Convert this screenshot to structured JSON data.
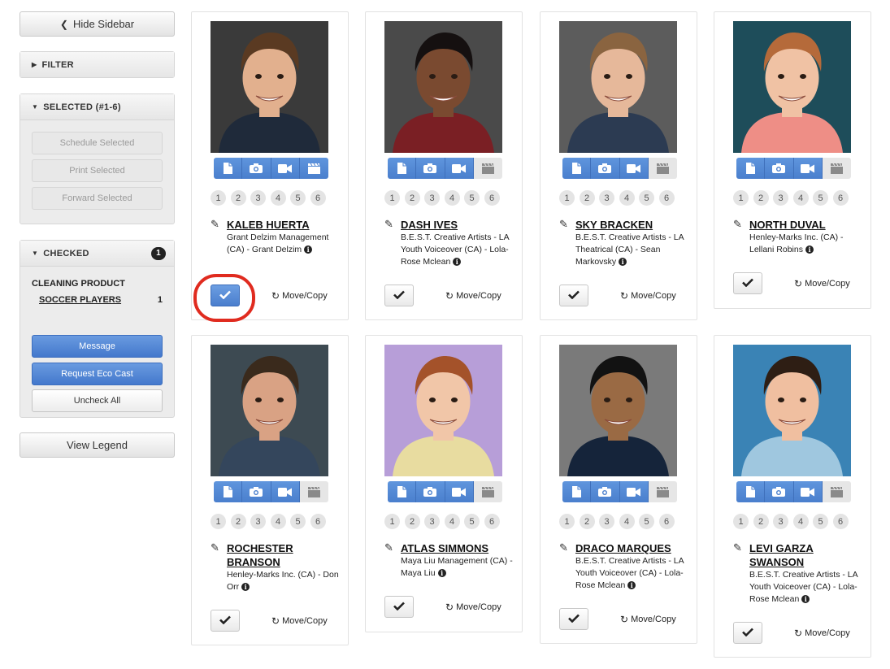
{
  "sidebar": {
    "hide_label": "Hide Sidebar",
    "filter_label": "FILTER",
    "selected": {
      "title": "SELECTED (#1-6)",
      "buttons": [
        "Schedule Selected",
        "Print Selected",
        "Forward Selected"
      ]
    },
    "checked": {
      "title": "CHECKED",
      "count": "1",
      "project": "CLEANING PRODUCT",
      "role": "SOCCER PLAYERS",
      "role_count": "1",
      "message_label": "Message",
      "eco_label": "Request Eco Cast",
      "uncheck_label": "Uncheck All"
    },
    "legend_label": "View Legend"
  },
  "card_common": {
    "numbers": [
      "1",
      "2",
      "3",
      "4",
      "5",
      "6"
    ],
    "move_label": "Move/Copy"
  },
  "cards": [
    {
      "name": "KALEB HUERTA",
      "agency": "Grant Delzim Management (CA) - Grant Delzim",
      "checked": true,
      "media_on": [
        true,
        true,
        true,
        true
      ],
      "bg": "#3a3a3a",
      "skin": "#e2b08e",
      "hair": "#5a3a22",
      "shirt": "#1f2a3a"
    },
    {
      "name": "DASH IVES",
      "agency": "B.E.S.T. Creative Artists - LA Youth Voiceover (CA) - Lola-Rose Mclean",
      "checked": false,
      "media_on": [
        true,
        true,
        true,
        false
      ],
      "bg": "#4a4a4a",
      "skin": "#7a4a30",
      "hair": "#151010",
      "shirt": "#7a1f24"
    },
    {
      "name": "SKY BRACKEN",
      "agency": "B.E.S.T. Creative Artists - LA Theatrical (CA) - Sean Markovsky",
      "checked": false,
      "media_on": [
        true,
        true,
        true,
        false
      ],
      "bg": "#5c5c5c",
      "skin": "#e6b89a",
      "hair": "#8a6440",
      "shirt": "#2c3b52"
    },
    {
      "name": "NORTH DUVAL",
      "agency": "Henley-Marks Inc. (CA) - Lellani Robins",
      "checked": false,
      "media_on": [
        true,
        true,
        true,
        false
      ],
      "bg": "#1e4d5a",
      "skin": "#f0c2a4",
      "hair": "#b56a3a",
      "shirt": "#ee8e86"
    },
    {
      "name": "ROCHESTER BRANSON",
      "agency": "Henley-Marks Inc. (CA) - Don Orr",
      "checked": false,
      "media_on": [
        true,
        true,
        true,
        false
      ],
      "bg": "#3d4a52",
      "skin": "#d9a284",
      "hair": "#3a2a1c",
      "shirt": "#34465c"
    },
    {
      "name": "ATLAS SIMMONS",
      "agency": "Maya Liu Management (CA) - Maya Liu",
      "checked": false,
      "media_on": [
        true,
        true,
        true,
        false
      ],
      "bg": "#b79ed8",
      "skin": "#f1c6a8",
      "hair": "#a4522a",
      "shirt": "#e8dca0"
    },
    {
      "name": "DRACO MARQUES",
      "agency": "B.E.S.T. Creative Artists - LA Youth Voiceover (CA) - Lola-Rose Mclean",
      "checked": false,
      "media_on": [
        true,
        true,
        true,
        false
      ],
      "bg": "#7a7a7a",
      "skin": "#9a6a44",
      "hair": "#121212",
      "shirt": "#15243a"
    },
    {
      "name": "LEVI GARZA SWANSON",
      "agency": "B.E.S.T. Creative Artists - LA Youth Voiceover (CA) - Lola-Rose Mclean",
      "checked": false,
      "media_on": [
        true,
        true,
        true,
        false
      ],
      "bg": "#3a83b5",
      "skin": "#f0bfa0",
      "hair": "#2e1e14",
      "shirt": "#9fc7df"
    }
  ],
  "colors": {
    "accent": "#4a7fcd",
    "highlight": "#e02b1f"
  },
  "icons": [
    "file-icon",
    "camera-icon",
    "video-icon",
    "clapper-icon",
    "pencil-icon",
    "info-icon",
    "check-icon",
    "refresh-icon"
  ]
}
